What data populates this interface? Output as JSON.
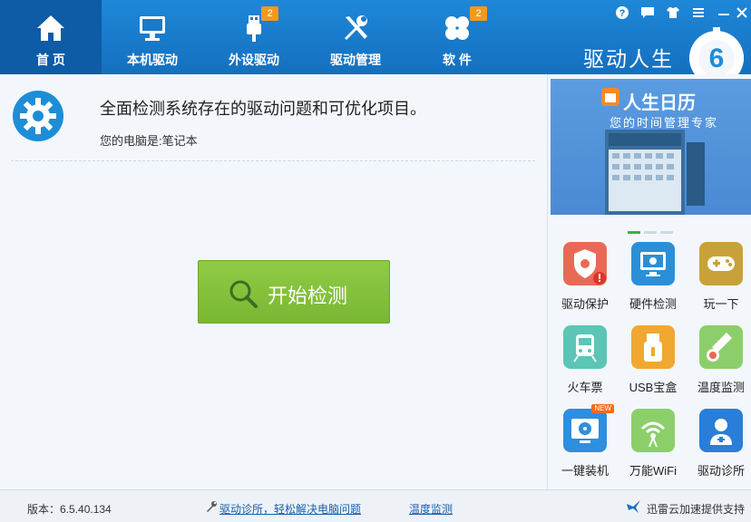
{
  "tabs": [
    {
      "label": "首 页",
      "icon": "home-icon",
      "active": true
    },
    {
      "label": "本机驱动",
      "icon": "monitor-icon"
    },
    {
      "label": "外设驱动",
      "icon": "usb-icon",
      "badge": "2"
    },
    {
      "label": "驱动管理",
      "icon": "tools-icon"
    },
    {
      "label": "软 件",
      "icon": "apps-icon",
      "badge": "2"
    }
  ],
  "brand": {
    "name": "驱动人生",
    "logo_text": "6"
  },
  "main": {
    "title": "全面检测系统存在的驱动问题和可优化项目。",
    "subtitle": "您的电脑是:笔记本",
    "start_label": "开始检测"
  },
  "banner": {
    "title": "人生日历",
    "subtitle": "您的时间管理专家",
    "slides": 3,
    "active_slide": 0
  },
  "tools": [
    {
      "label": "驱动保护",
      "color": "#e86a55",
      "icon": "shield-gear-icon"
    },
    {
      "label": "硬件检测",
      "color": "#2b8fd8",
      "icon": "monitor-check-icon"
    },
    {
      "label": "玩一下",
      "color": "#c9a13a",
      "icon": "gamepad-icon"
    },
    {
      "label": "火车票",
      "color": "#5cc5b5",
      "icon": "train-icon"
    },
    {
      "label": "USB宝盒",
      "color": "#f0a830",
      "icon": "usb-box-icon"
    },
    {
      "label": "温度监测",
      "color": "#8ccf6a",
      "icon": "thermometer-icon"
    },
    {
      "label": "一键装机",
      "color": "#2e8ee0",
      "icon": "disc-icon",
      "new": "NEW"
    },
    {
      "label": "万能WiFi",
      "color": "#8ccf6a",
      "icon": "wifi-icon"
    },
    {
      "label": "驱动诊所",
      "color": "#2a7ed8",
      "icon": "doctor-icon"
    }
  ],
  "footer": {
    "version": "版本：6.5.40.134",
    "clinic_link": "驱动诊所，轻松解决电脑问题",
    "temp_link": "温度监测",
    "provider": "迅雷云加速提供支持"
  },
  "colors": {
    "topbar": "#1f87d8",
    "active_tab": "#0e5ba6",
    "start_button": "#8fcb44",
    "badge": "#f39a1e"
  }
}
